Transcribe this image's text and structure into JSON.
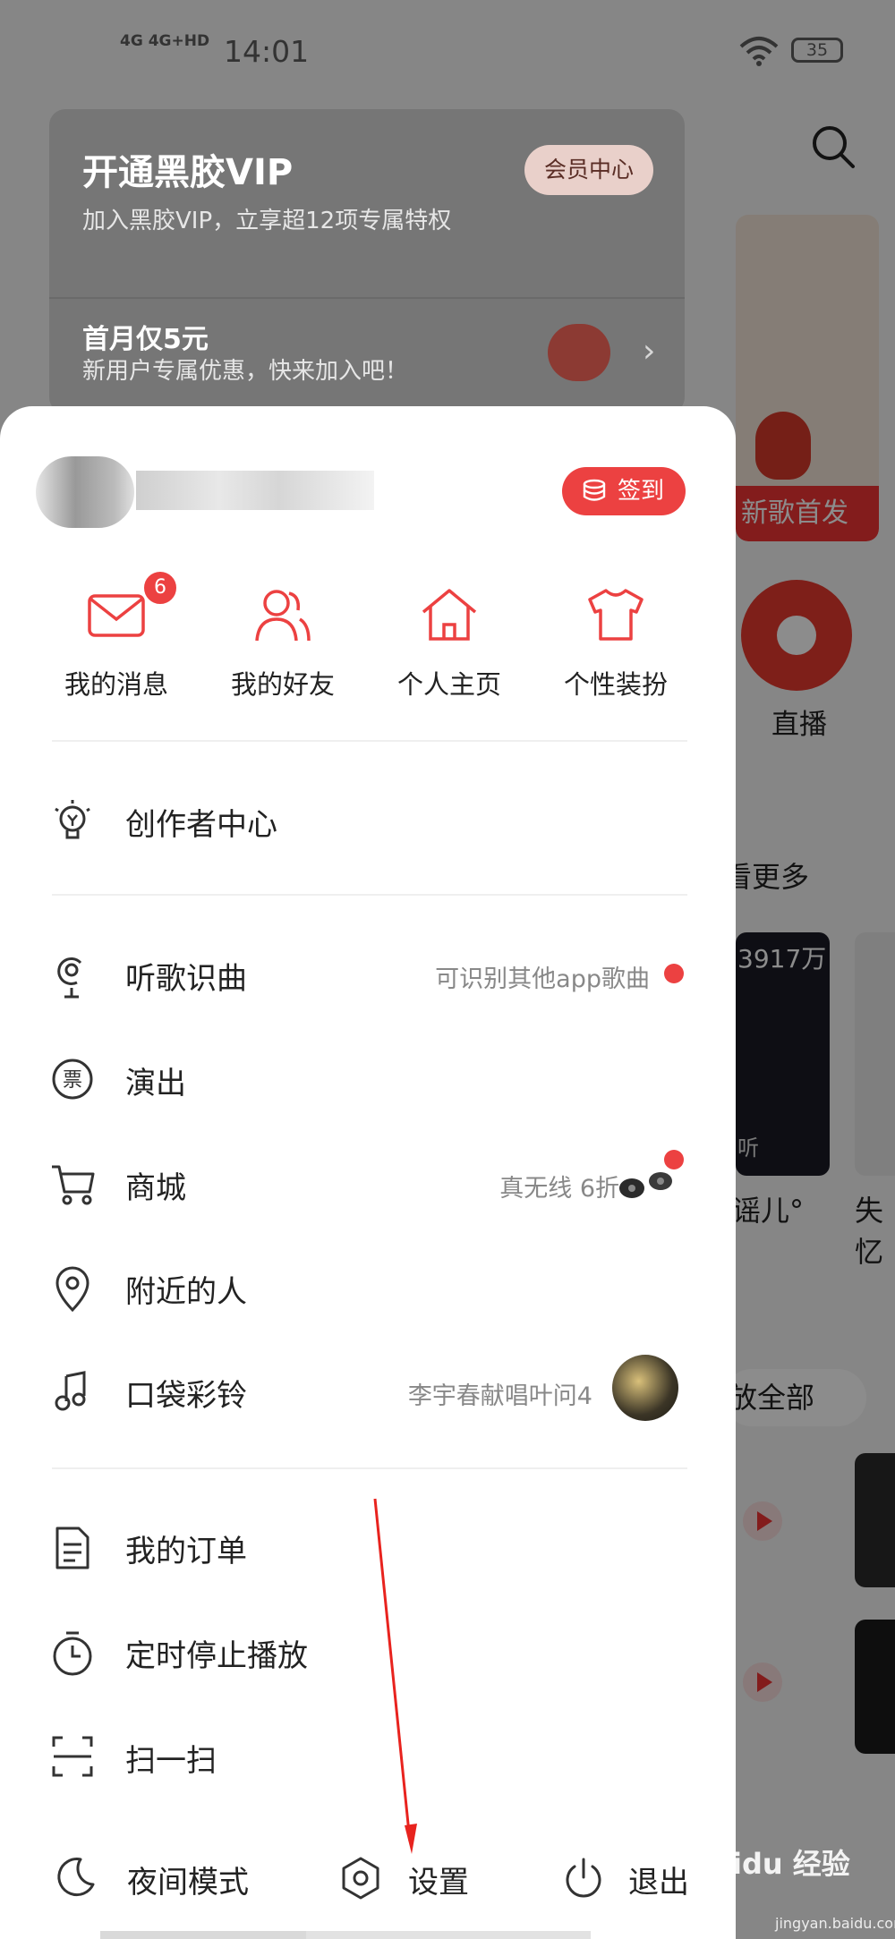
{
  "status_bar": {
    "network": "4G 4G+HD",
    "time": "14:01",
    "battery": "35"
  },
  "vip_card": {
    "title": "开通黑胶VIP",
    "subtitle": "加入黑胶VIP，立享超12项专属特权",
    "button": "会员中心",
    "promo_title": "首月仅5元",
    "promo_subtitle": "新用户专属优惠，快来加入吧！"
  },
  "background": {
    "banner_tag": "新歌首发",
    "live_label": "直播",
    "see_more": "看更多",
    "card_count": "3917万",
    "card_label": "听",
    "song1": "谣儿°",
    "song2": "失忆",
    "play_all": "放全部"
  },
  "drawer": {
    "signin_label": "签到",
    "quick_actions": [
      {
        "label": "我的消息",
        "icon": "mail-icon",
        "badge": "6"
      },
      {
        "label": "我的好友",
        "icon": "friends-icon"
      },
      {
        "label": "个人主页",
        "icon": "home-icon"
      },
      {
        "label": "个性装扮",
        "icon": "tshirt-icon"
      }
    ],
    "creator": {
      "label": "创作者中心",
      "icon": "lightbulb-icon"
    },
    "menu": [
      {
        "label": "听歌识曲",
        "icon": "microphone-icon",
        "hint": "可识别其他app歌曲"
      },
      {
        "label": "演出",
        "icon": "ticket-icon",
        "hint": ""
      },
      {
        "label": "商城",
        "icon": "cart-icon",
        "hint": "真无线 6折"
      },
      {
        "label": "附近的人",
        "icon": "location-pin-icon",
        "hint": ""
      },
      {
        "label": "口袋彩铃",
        "icon": "ringtone-icon",
        "hint": "李宇春献唱叶问4"
      }
    ],
    "menu2": [
      {
        "label": "我的订单",
        "icon": "order-icon"
      },
      {
        "label": "定时停止播放",
        "icon": "timer-icon"
      },
      {
        "label": "扫一扫",
        "icon": "scan-icon"
      }
    ],
    "bottom": [
      {
        "label": "夜间模式",
        "icon": "moon-icon"
      },
      {
        "label": "设置",
        "icon": "settings-hexagon-icon"
      },
      {
        "label": "退出",
        "icon": "power-icon"
      }
    ]
  },
  "watermark": {
    "text": "Baidu 经验",
    "sub": "jingyan.baidu.com"
  },
  "colors": {
    "accent": "#ec4141",
    "annotation_arrow": "#e8231e"
  }
}
